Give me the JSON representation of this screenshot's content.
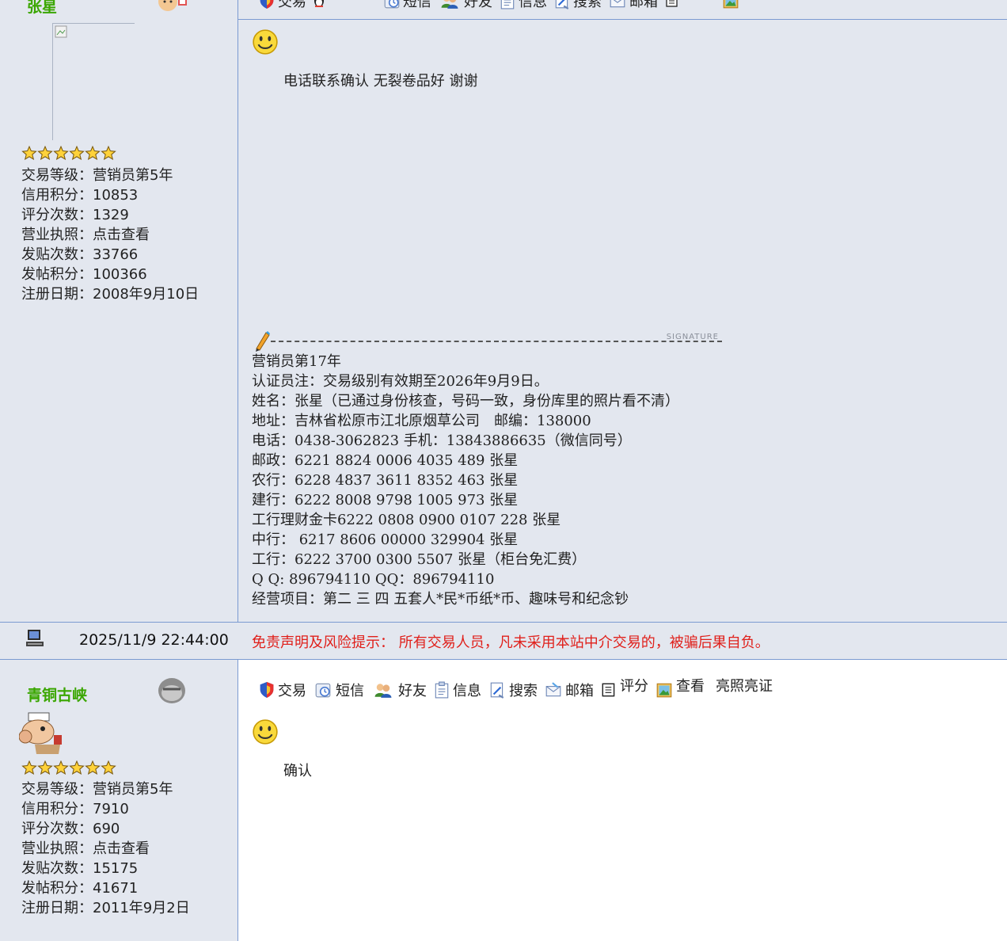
{
  "colors": {
    "username": "#3aa600",
    "disclaimer": "#e0201b",
    "border": "#7b9ad1",
    "background": "#e3e7ef"
  },
  "toolbar_labels": {
    "trade": "交易",
    "sms": "短信",
    "friend": "好友",
    "info": "信息",
    "search": "搜索",
    "mailbox": "邮箱",
    "rate": "评分",
    "view": "查看",
    "license": "亮照亮证"
  },
  "post1": {
    "author": {
      "name": "张星",
      "stats": [
        {
          "label": "交易等级：",
          "value": "营销员第5年"
        },
        {
          "label": "信用积分：",
          "value": "10853"
        },
        {
          "label": "评分次数：",
          "value": "1329"
        },
        {
          "label": "营业执照：",
          "value": "点击查看"
        },
        {
          "label": "发贴次数：",
          "value": "33766"
        },
        {
          "label": "发帖积分：",
          "value": "100366"
        },
        {
          "label": "注册日期：",
          "value": "2008年9月10日"
        }
      ]
    },
    "message": "电话联系确认 无裂卷品好 谢谢",
    "signature_tag": "SIGNATURE",
    "signature_lines": [
      "营销员第17年",
      "认证员注：交易级别有效期至2026年9月9日。",
      "姓名：张星（已通过身份核查，号码一致，身份库里的照片看不清）",
      "地址：吉林省松原市江北原烟草公司　邮编：138000",
      "电话：0438-3062823  手机：13843886635（微信同号）",
      "邮政：6221 8824 0006 4035 489 张星",
      "农行：6228 4837 3611 8352 463 张星",
      "建行：6222 8008 9798 1005 973 张星",
      "工行理财金卡6222 0808 0900 0107 228 张星",
      "中行： 6217 8606 00000 329904 张星",
      "工行：6222 3700 0300 5507     张星（柜台免汇费）",
      "Q Q:   896794110   QQ：896794110",
      "经营项目：第二 三 四 五套人*民*币纸*币、趣味号和纪念钞"
    ]
  },
  "footer": {
    "timestamp": "2025/11/9 22:44:00",
    "disclaimer": "免责声明及风险提示： 所有交易人员，凡未采用本站中介交易的，被骗后果自负。"
  },
  "post2": {
    "author": {
      "name": "青铜古峡",
      "stats": [
        {
          "label": "交易等级：",
          "value": "营销员第5年"
        },
        {
          "label": "信用积分：",
          "value": "7910"
        },
        {
          "label": "评分次数：",
          "value": "690"
        },
        {
          "label": "营业执照：",
          "value": "点击查看"
        },
        {
          "label": "发贴次数：",
          "value": "15175"
        },
        {
          "label": "发帖积分：",
          "value": "41671"
        },
        {
          "label": "注册日期：",
          "value": "2011年9月2日"
        }
      ]
    },
    "message": "确认"
  }
}
